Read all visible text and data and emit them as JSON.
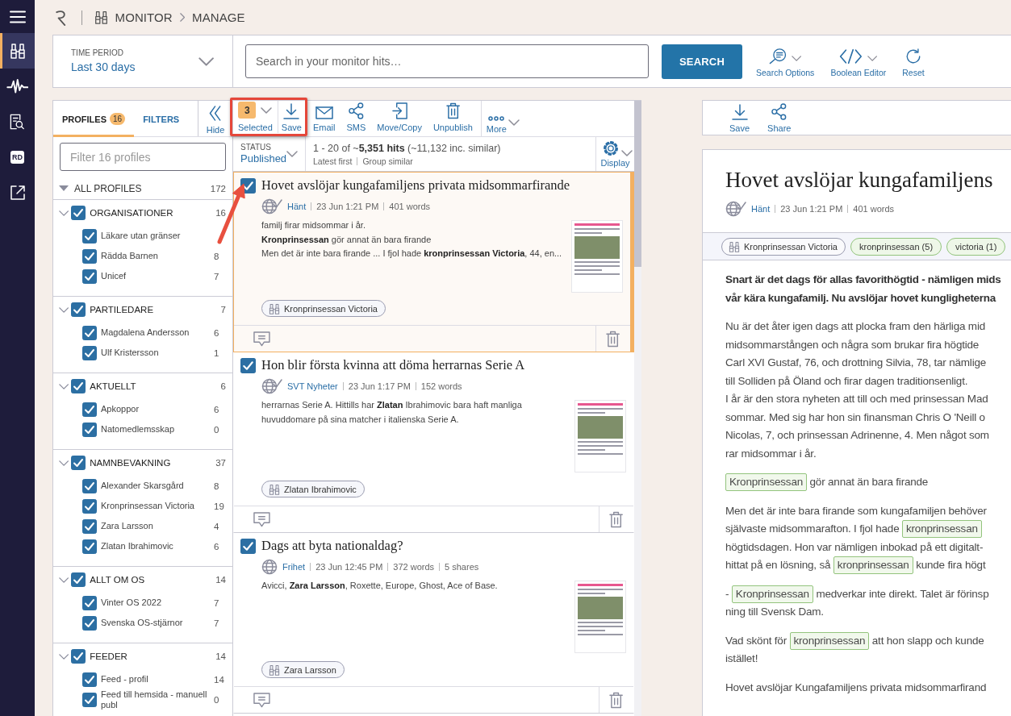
{
  "nav_rail": {
    "items": [
      {
        "kind": "monitor",
        "selected": true
      },
      {
        "kind": "analytics",
        "selected": false
      },
      {
        "kind": "search",
        "selected": false
      },
      {
        "kind": "badge",
        "label": "RD",
        "selected": false
      },
      {
        "kind": "external",
        "selected": false
      }
    ]
  },
  "breadcrumb": [
    "MONITOR",
    "MANAGE"
  ],
  "search_panel": {
    "time_period": {
      "label": "TIME PERIOD",
      "value": "Last 30 days"
    },
    "search": {
      "placeholder": "Search in your monitor hits…"
    },
    "button": "SEARCH",
    "tools": [
      {
        "kind": "search_options",
        "label": "Search Options",
        "dropdown": true
      },
      {
        "kind": "boolean",
        "label": "Boolean Editor",
        "dropdown": true
      },
      {
        "kind": "reset",
        "label": "Reset",
        "dropdown": false
      }
    ]
  },
  "profiles_panel": {
    "tabs": [
      {
        "label": "PROFILES",
        "count": "16",
        "selected": true
      },
      {
        "label": "FILTERS",
        "selected": false
      }
    ],
    "hide_button": "Hide",
    "filter": {
      "placeholder": "Filter 16 profiles"
    },
    "all_profiles": {
      "label": "ALL PROFILES",
      "count": "172",
      "expanded": true
    },
    "groups": [
      {
        "name": "ORGANISATIONER",
        "count": "16",
        "checked": true,
        "expanded": true,
        "children": [
          {
            "name": "Läkare utan gränser",
            "checked": true
          },
          {
            "name": "Rädda Barnen",
            "count": "8",
            "checked": true
          },
          {
            "name": "Unicef",
            "count": "7",
            "checked": true
          }
        ]
      },
      {
        "name": "PARTILEDARE",
        "count": "7",
        "checked": true,
        "expanded": true,
        "children": [
          {
            "name": "Magdalena Andersson",
            "count": "6",
            "checked": true
          },
          {
            "name": "Ulf Kristersson",
            "count": "1",
            "checked": true
          }
        ]
      },
      {
        "name": "AKTUELLT",
        "count": "6",
        "checked": true,
        "expanded": true,
        "children": [
          {
            "name": "Apkoppor",
            "count": "6",
            "checked": true
          },
          {
            "name": "Natomedlemsskap",
            "count": "0",
            "checked": true
          }
        ]
      },
      {
        "name": "NAMNBEVAKNING",
        "count": "37",
        "checked": true,
        "expanded": true,
        "children": [
          {
            "name": "Alexander Skarsgård",
            "count": "8",
            "checked": true
          },
          {
            "name": "Kronprinsessan Victoria",
            "count": "19",
            "checked": true
          },
          {
            "name": "Zara Larsson",
            "count": "4",
            "checked": true
          },
          {
            "name": "Zlatan Ibrahimovic",
            "count": "6",
            "checked": true
          }
        ]
      },
      {
        "name": "ALLT OM OS",
        "count": "14",
        "checked": true,
        "expanded": true,
        "children": [
          {
            "name": "Vinter OS 2022",
            "count": "7",
            "checked": true
          },
          {
            "name": "Svenska OS-stjärnor",
            "count": "7",
            "checked": true
          }
        ]
      },
      {
        "name": "FEEDER",
        "count": "14",
        "checked": true,
        "expanded": true,
        "children": [
          {
            "name": "Feed - profil",
            "count": "14",
            "checked": true
          },
          {
            "name": "Feed till hemsida - manuell publ",
            "count": "0",
            "checked": true
          }
        ]
      }
    ]
  },
  "list_toolbar": {
    "actions": [
      {
        "kind": "selected",
        "count": "3",
        "label": "Selected",
        "dropdown": true
      },
      {
        "kind": "save",
        "label": "Save",
        "dropdown": false
      },
      {
        "kind": "email",
        "label": "Email",
        "dropdown": false
      },
      {
        "kind": "sms",
        "label": "SMS",
        "dropdown": false
      },
      {
        "kind": "move",
        "label": "Move/Copy",
        "dropdown": false
      },
      {
        "kind": "unpublish",
        "label": "Unpublish",
        "dropdown": false
      },
      {
        "kind": "more",
        "label": "More",
        "dropdown": true
      }
    ]
  },
  "status_bar": {
    "status_label": "STATUS",
    "status_value": "Published",
    "summary": "1 - 20 of ~**5,351 hits** (~11,132 inc. similar)",
    "sort": "Latest first",
    "grouping": "Group similar",
    "display": "Display"
  },
  "articles": [
    {
      "title": "Hovet avslöjar kungafamiljens privata midsommarfirande",
      "checked": true,
      "selected": true,
      "verified": true,
      "source": "Hänt",
      "date": "23 Jun 1:21 PM",
      "words": "401 words",
      "snippet": [
        "familj firar midsommar i år.",
        "**Kronprinsessan** gör annat än bara firande",
        "Men det är inte bara firande ... I fjol hade **kronprinsessan Victoria**, 44, en..."
      ],
      "tags": [
        "Kronprinsessan Victoria"
      ]
    },
    {
      "title": "Hon blir första kvinna att döma herrarnas Serie A",
      "checked": true,
      "selected": false,
      "verified": true,
      "source": "SVT Nyheter",
      "date": "23 Jun 1:17 PM",
      "words": "152 words",
      "snippet": [
        "herrarnas Serie A. Hittills har **Zlatan** Ibrahimovic bara haft manliga huvuddomare på sina matcher i italienska Serie A."
      ],
      "tags": [
        "Zlatan Ibrahimovic"
      ]
    },
    {
      "title": "Dags att byta nationaldag?",
      "checked": true,
      "selected": false,
      "verified": false,
      "source": "Frihet",
      "date": "23 Jun 12:45 PM",
      "words": "372 words",
      "shares": "5 shares",
      "snippet": [
        "Avicci, **Zara Larsson**, Roxette, Europe, Ghost, Ace of Base."
      ],
      "tags": [
        "Zara Larsson"
      ]
    }
  ],
  "reader": {
    "toolbar": [
      {
        "kind": "save",
        "label": "Save"
      },
      {
        "kind": "share",
        "label": "Share"
      }
    ],
    "title": "Hovet avslöjar kungafamiljens",
    "verified": true,
    "source": "Hänt",
    "date": "23 Jun 1:21 PM",
    "words": "401 words",
    "tags": [
      {
        "kind": "profile",
        "label": "Kronprinsessan Victoria"
      },
      {
        "kind": "keyword",
        "label": "kronprinsessan (5)"
      },
      {
        "kind": "keyword",
        "label": "victoria (1)"
      }
    ],
    "paragraphs": [
      {
        "kind": "lead",
        "lines": [
          [
            {
              "kind": "text",
              "text": "Snart är det dags för allas favorithögtid - nämligen mids"
            }
          ],
          [
            {
              "kind": "text",
              "text": "vår kära kungafamilj. Nu avslöjar hovet kungligheterna"
            }
          ]
        ]
      },
      {
        "kind": "body",
        "lines": [
          [
            {
              "kind": "text",
              "text": "Nu är det åter igen dags att plocka fram den härliga mid"
            }
          ],
          [
            {
              "kind": "text",
              "text": "midsommarstången och några som brukar fira högtide"
            }
          ],
          [
            {
              "kind": "text",
              "text": "Carl XVI Gustaf, 76, och drottning Silvia, 78, tar nämlige"
            }
          ],
          [
            {
              "kind": "text",
              "text": "till Solliden på Öland och firar dagen traditionsenligt."
            }
          ],
          [
            {
              "kind": "text",
              "text": "I år är den stora nyheten att till och med prinsessan Mad"
            }
          ],
          [
            {
              "kind": "text",
              "text": "sommar. Med sig har hon sin finansman Chris O 'Neill o"
            }
          ],
          [
            {
              "kind": "text",
              "text": "Nicolas, 7, och prinsessan Adrinenne, 4. Men något som"
            }
          ],
          [
            {
              "kind": "text",
              "text": "rar midsommar i år."
            }
          ]
        ]
      },
      {
        "kind": "body",
        "lines": [
          [
            {
              "kind": "keyword",
              "text": "Kronprinsessan"
            },
            {
              "kind": "text",
              "text": " gör annat än bara firande"
            }
          ]
        ]
      },
      {
        "kind": "body",
        "lines": [
          [
            {
              "kind": "text",
              "text": "Men det är inte bara firande som kungafamiljen behöver"
            }
          ],
          [
            {
              "kind": "text",
              "text": "självaste midsommarafton. I fjol hade "
            },
            {
              "kind": "keyword",
              "text": "kronprinsessan"
            }
          ],
          [
            {
              "kind": "text",
              "text": "högtidsdagen. Hon var nämligen inbokad på ett digitalt-"
            }
          ],
          [
            {
              "kind": "text",
              "text": "hittat på en lösning, så "
            },
            {
              "kind": "keyword",
              "text": "kronprinsessan"
            },
            {
              "kind": "text",
              "text": " kunde fira högt"
            }
          ]
        ]
      },
      {
        "kind": "body",
        "lines": [
          [
            {
              "kind": "text",
              "text": "- "
            },
            {
              "kind": "keyword",
              "text": "Kronprinsessan"
            },
            {
              "kind": "text",
              "text": " medverkar inte direkt. Talet är förinsp"
            }
          ],
          [
            {
              "kind": "text",
              "text": "ning till Svensk Dam."
            }
          ]
        ]
      },
      {
        "kind": "body",
        "lines": [
          [
            {
              "kind": "text",
              "text": "Vad skönt för "
            },
            {
              "kind": "keyword",
              "text": "kronprinsessan"
            },
            {
              "kind": "text",
              "text": " att hon slapp och kunde"
            }
          ],
          [
            {
              "kind": "text",
              "text": "istället!"
            }
          ]
        ]
      },
      {
        "kind": "body",
        "lines": [
          [
            {
              "kind": "text",
              "text": "Hovet avslöjar Kungafamiljens privata midsommarfirand"
            }
          ]
        ]
      }
    ]
  },
  "annotations": {
    "highlight_frame": true,
    "pointer_arrow": true
  }
}
